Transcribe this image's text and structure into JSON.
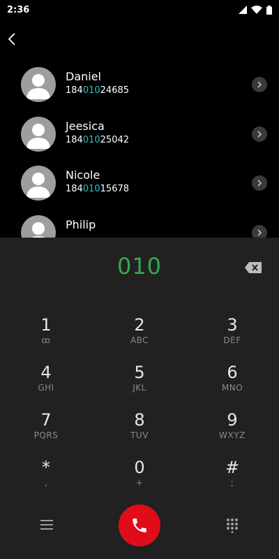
{
  "status_bar": {
    "time": "2:36",
    "icons": [
      "cell-signal-icon",
      "wifi-icon",
      "battery-icon"
    ]
  },
  "header": {
    "back_icon": "chevron-left-icon"
  },
  "contacts": [
    {
      "name": "Daniel",
      "number_prefix": "184",
      "number_match": "010",
      "number_suffix": "24685"
    },
    {
      "name": "Jeesica",
      "number_prefix": "184",
      "number_match": "010",
      "number_suffix": "25042"
    },
    {
      "name": "Nicole",
      "number_prefix": "184",
      "number_match": "010",
      "number_suffix": "15678"
    },
    {
      "name": "Philip",
      "number_prefix": "",
      "number_match": "",
      "number_suffix": ""
    }
  ],
  "dialpad": {
    "dialed_number": "010",
    "keys": [
      {
        "digit": "1",
        "letters": "ꝏ"
      },
      {
        "digit": "2",
        "letters": "ABC"
      },
      {
        "digit": "3",
        "letters": "DEF"
      },
      {
        "digit": "4",
        "letters": "GHI"
      },
      {
        "digit": "5",
        "letters": "JKL"
      },
      {
        "digit": "6",
        "letters": "MNO"
      },
      {
        "digit": "7",
        "letters": "PQRS"
      },
      {
        "digit": "8",
        "letters": "TUV"
      },
      {
        "digit": "9",
        "letters": "WXYZ"
      },
      {
        "digit": "*",
        "letters": ","
      },
      {
        "digit": "0",
        "letters": "+"
      },
      {
        "digit": "#",
        "letters": ";"
      }
    ]
  },
  "colors": {
    "dialed_text": "#34a853",
    "match_highlight": "#27c2c2",
    "call_button": "#e10c1a",
    "dialpad_background": "#212121"
  }
}
